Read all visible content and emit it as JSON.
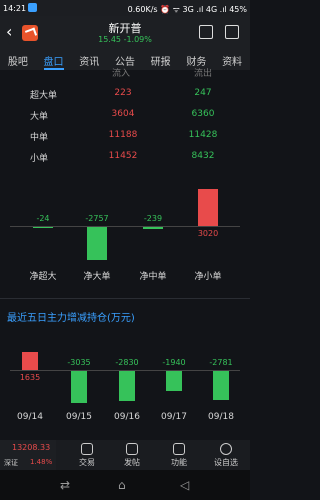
{
  "status": {
    "time": "14:21",
    "right": "0.60K/s ⏰ ᯤ 3G .ıl 4G .ıl 45%"
  },
  "header": {
    "name": "新开普",
    "price": "15.45",
    "change": "-1.09%"
  },
  "tabs": [
    "股吧",
    "盘口",
    "资讯",
    "公告",
    "研报",
    "财务",
    "资料"
  ],
  "flow_header": {
    "in": "流入",
    "out": "流出"
  },
  "flows": [
    {
      "label": "超大单",
      "in": "223",
      "out": "247"
    },
    {
      "label": "大单",
      "in": "3604",
      "out": "6360"
    },
    {
      "label": "中单",
      "in": "11188",
      "out": "11428"
    },
    {
      "label": "小单",
      "in": "11452",
      "out": "8432"
    }
  ],
  "chart_data": [
    {
      "type": "bar",
      "categories": [
        "净超大",
        "净大单",
        "净中单",
        "净小单"
      ],
      "values": [
        -24,
        -2757,
        -239,
        3020
      ],
      "labels": [
        "-24",
        "-2757",
        "-239",
        "3020"
      ]
    },
    {
      "type": "bar",
      "title": "最近五日主力增减持仓(万元)",
      "categories": [
        "09/14",
        "09/15",
        "09/16",
        "09/17",
        "09/18"
      ],
      "values": [
        1635,
        -3035,
        -2830,
        -1940,
        -2781
      ],
      "labels": [
        "1635",
        "-3035",
        "-2830",
        "-1940",
        "-2781"
      ]
    }
  ],
  "index": {
    "value": "13208.33",
    "name": "深证",
    "pct": "1.48%"
  },
  "nav": [
    "交易",
    "发帖",
    "功能",
    "设自选"
  ],
  "colors": {
    "up": "#e84b4b",
    "down": "#36c25a",
    "accent": "#3aa0ff"
  }
}
